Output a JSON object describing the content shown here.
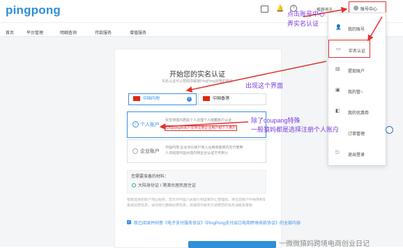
{
  "header": {
    "logo": "pingpong",
    "account_label": "账号中心",
    "notify_label": "推荐有礼"
  },
  "nav": {
    "items": [
      "首页",
      "平台管理",
      "明细查询",
      "付款服务",
      "增值服务"
    ]
  },
  "main": {
    "title": "开始您的实名认证",
    "subtitle": "实名认证可以帮助您解锁PingPong完整的服务",
    "regions": [
      {
        "label": "中国内地",
        "selected": true
      },
      {
        "label": "中国香港",
        "selected": false
      }
    ],
    "options": [
      {
        "label": "个人账户",
        "desc_line1": "仅支持境内居民个人办理个人储蓄账户认证",
        "desc_note": "Coupang新账户支持注册企业用户和个人用户",
        "selected": true
      },
      {
        "label": "企业账户",
        "desc_line1": "中国内地 企业对公账户收入及用资金境内支付使用",
        "desc_line2": "人须完成中国大陆内地企业认证方可执行",
        "selected": false
      }
    ],
    "docs_title": "您需要准备的材料：",
    "docs_item": "大陆身份证 / 港澳台居民居住证",
    "fine_print_1": "根据选择的账户地区服务，您允许中国人民银行和国家外汇管理局，将在您账户中保存和使用",
    "fine_print_2": "金融监管信息，请勿自行删除此类信息，如遇境外服务方调用您的信息请联系客服",
    "agreement": "我已阅读并同意《电子支付服务协议》《PingPong支付出口电商跨境收款协议》的全部内容"
  },
  "dropdown": {
    "items": [
      "我的账号",
      "实名认证",
      "提现账户",
      "我的管~",
      "我的优惠券",
      "订单管理",
      "退出登录"
    ]
  },
  "annotations": {
    "a1_line1": "点击账号中心",
    "a1_line2": "弄实名认证",
    "a2": "出现这个界面",
    "a3_line1": "除了coupang特殊",
    "a3_line2": "一般猿妈都是选择注册个人账户",
    "watermark": "一微微猿妈跨境电商创业日记"
  },
  "colors": {
    "brand": "#2f8fd8",
    "annotation": "#7a3de0",
    "arrow": "#e0322e"
  }
}
